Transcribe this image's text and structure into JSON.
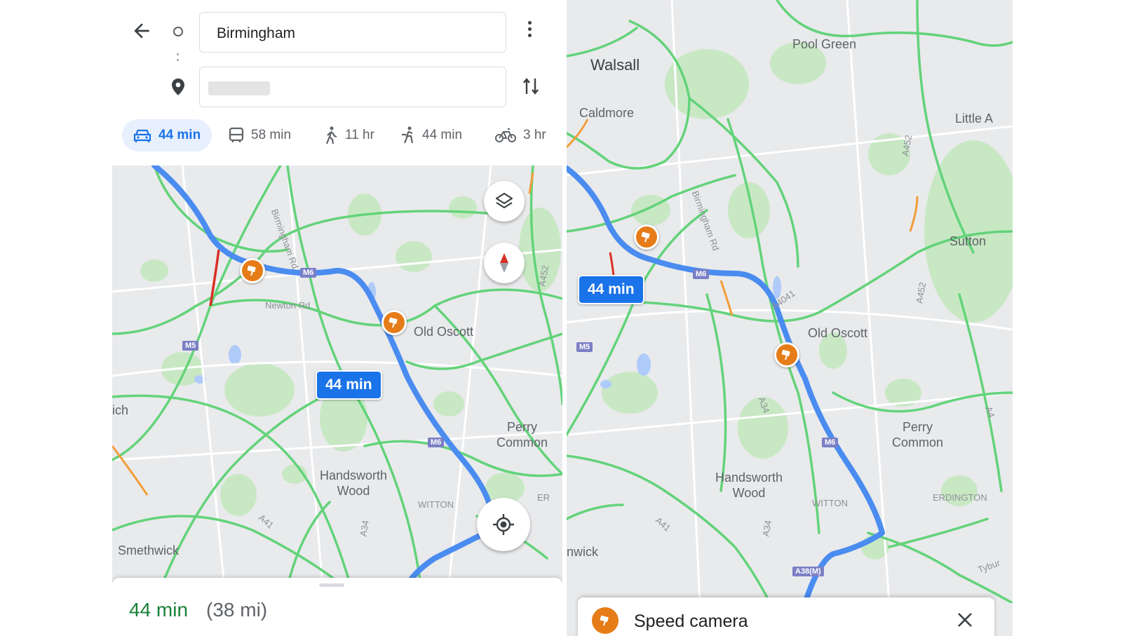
{
  "left": {
    "origin": "Birmingham",
    "modes": [
      {
        "icon": "car-icon",
        "label": "44 min",
        "active": true
      },
      {
        "icon": "bus-icon",
        "label": "58 min",
        "active": false
      },
      {
        "icon": "walk-icon",
        "label": "11 hr",
        "active": false
      },
      {
        "icon": "rideshare-icon",
        "label": "44 min",
        "active": false
      },
      {
        "icon": "bike-icon",
        "label": "3 hr",
        "active": false
      }
    ],
    "route_bubble": "44 min",
    "places": {
      "old_oscott": "Old Oscott",
      "perry_common": "Perry\nCommon",
      "handsworth": "Handsworth\nWood",
      "smethwick": "Smethwick",
      "ich": "ich",
      "witton": "WITTON",
      "er": "ER"
    },
    "roads": {
      "birmingham_rd": "Birmingham Rd",
      "newton_rd": "Newton Rd",
      "a452": "A452",
      "a41": "A41",
      "a34": "A34",
      "m6": "M6",
      "m5": "M5"
    },
    "sheet": {
      "eta": "44 min",
      "distance": "(38 mi)"
    }
  },
  "right": {
    "route_bubble": "44 min",
    "places": {
      "walsall": "Walsall",
      "pool_green": "Pool Green",
      "caldmore": "Caldmore",
      "little": "Little A",
      "sutton": "Sutton",
      "old_oscott": "Old Oscott",
      "perry_common": "Perry\nCommon",
      "handsworth": "Handsworth\nWood",
      "wick": "nwick",
      "witton": "WITTON",
      "erdington": "ERDINGTON",
      "tyburn": "Tybur"
    },
    "roads": {
      "birmingham_rd": "Birmingham Rd",
      "a4041": "A4041",
      "a452": "A452",
      "a452b": "A452",
      "a41": "A41",
      "a34": "A34",
      "m6": "M6",
      "m5": "M5",
      "a38m": "A38(M)",
      "a4": "A4"
    },
    "sheet": {
      "title": "Speed camera"
    }
  },
  "colors": {
    "route": "#4a8cf0",
    "traffic_green": "#63d37a",
    "traffic_orange": "#f29d38",
    "traffic_red": "#d93025",
    "park": "#c8e8c4",
    "camera": "#e67c17"
  }
}
